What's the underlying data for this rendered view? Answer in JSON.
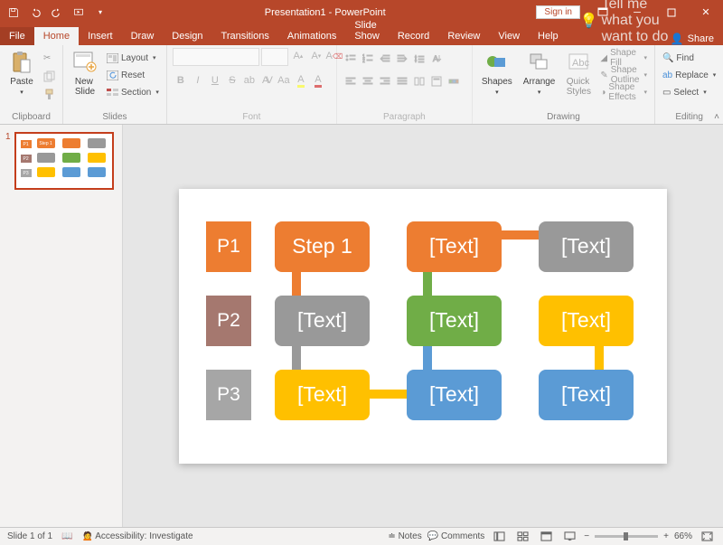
{
  "titlebar": {
    "title": "Presentation1 - PowerPoint",
    "signin": "Sign in"
  },
  "tabs": {
    "file": "File",
    "home": "Home",
    "insert": "Insert",
    "draw": "Draw",
    "design": "Design",
    "transitions": "Transitions",
    "animations": "Animations",
    "slideshow": "Slide Show",
    "record": "Record",
    "review": "Review",
    "view": "View",
    "help": "Help",
    "tellme": "Tell me what you want to do",
    "share": "Share"
  },
  "ribbon": {
    "clipboard": {
      "label": "Clipboard",
      "paste": "Paste"
    },
    "slides": {
      "label": "Slides",
      "newslide": "New\nSlide",
      "layout": "Layout",
      "reset": "Reset",
      "section": "Section"
    },
    "font": {
      "label": "Font"
    },
    "paragraph": {
      "label": "Paragraph"
    },
    "drawing": {
      "label": "Drawing",
      "shapes": "Shapes",
      "arrange": "Arrange",
      "quick": "Quick\nStyles",
      "fill": "Shape Fill",
      "outline": "Shape Outline",
      "effects": "Shape Effects"
    },
    "editing": {
      "label": "Editing",
      "find": "Find",
      "replace": "Replace",
      "select": "Select"
    }
  },
  "slide": {
    "labels": [
      "P1",
      "P2",
      "P3"
    ],
    "boxes": {
      "r1c1": "Step 1",
      "r1c2": "[Text]",
      "r1c3": "[Text]",
      "r2c1": "[Text]",
      "r2c2": "[Text]",
      "r2c3": "[Text]",
      "r3c1": "[Text]",
      "r3c2": "[Text]",
      "r3c3": "[Text]"
    },
    "colors": {
      "orange": "#ed7d31",
      "gray": "#999999",
      "brown": "#a5786f",
      "green": "#70ad47",
      "gold": "#ffc000",
      "blue": "#5b9bd5",
      "gray2": "#a6a6a6"
    }
  },
  "statusbar": {
    "slide_of": "Slide 1 of 1",
    "lang": "",
    "access": "Accessibility: Investigate",
    "notes": "Notes",
    "comments": "Comments",
    "zoom": "66%"
  },
  "thumb": {
    "num": "1",
    "r1c1": "Step 1"
  }
}
